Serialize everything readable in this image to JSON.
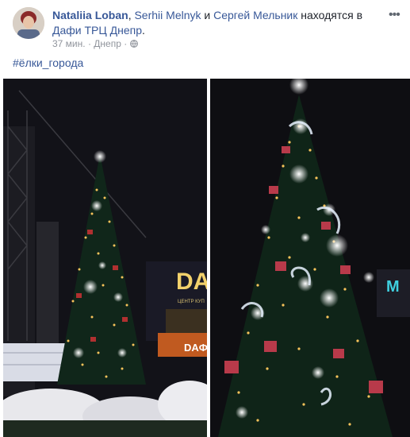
{
  "post": {
    "author": "Nataliia Loban",
    "tagged_sep": ", ",
    "tagged_1": "Serhii Melnyk",
    "tagged_conj": " и ",
    "tagged_2": "Сергей Мельник",
    "status_text": " находятся в ",
    "location": "Дафи ТРЦ Днепр",
    "location_end": ".",
    "time": "37 мин.",
    "dot": " · ",
    "city": "Днепр",
    "dot2": " · ",
    "privacy_icon": "globe-icon",
    "more_icon": "more-options-icon",
    "hashtag": "#ёлки_города"
  },
  "photos": {
    "left_sign_1": "DA",
    "left_sign_2": "DAФ",
    "left_sign_3": "ЦЕНТР КУП",
    "right_sign": "M"
  },
  "colors": {
    "link": "#385898",
    "meta": "#90949c",
    "text": "#1d2129"
  }
}
